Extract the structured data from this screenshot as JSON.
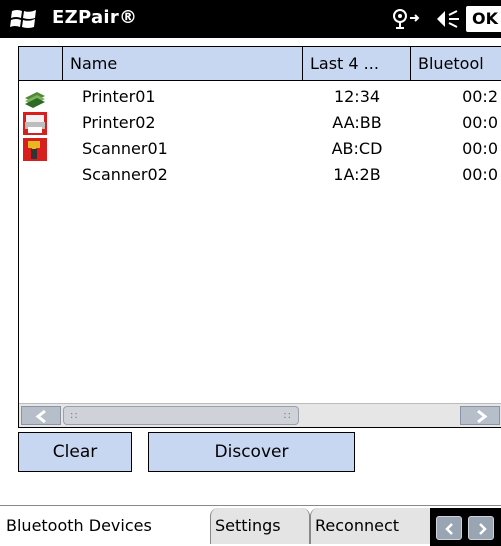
{
  "titlebar": {
    "app_title": "EZPair®",
    "ok_label": "OK",
    "start_icon": "windows-flag-icon",
    "connectivity_icon": "connectivity-icon",
    "speaker_icon": "speaker-icon"
  },
  "list": {
    "columns": [
      "Name",
      "Last 4 ...",
      "Bluetool"
    ],
    "rows": [
      {
        "icon": "printer-stack-icon",
        "name": "Printer01",
        "last4": "12:34",
        "bt": "00:2"
      },
      {
        "icon": "printer-icon",
        "name": "Printer02",
        "last4": "AA:BB",
        "bt": "00:0"
      },
      {
        "icon": "scanner-icon",
        "name": "Scanner01",
        "last4": "AB:CD",
        "bt": "00:0"
      },
      {
        "icon": "",
        "name": "Scanner02",
        "last4": "1A:2B",
        "bt": "00:0"
      }
    ]
  },
  "buttons": {
    "clear": "Clear",
    "discover": "Discover"
  },
  "tabs": [
    {
      "label": "Bluetooth Devices",
      "selected": true
    },
    {
      "label": "Settings",
      "selected": false
    },
    {
      "label": "Reconnect",
      "selected": false
    }
  ],
  "colors": {
    "header_bg": "#c8d7f1",
    "titlebar_bg": "#000000"
  }
}
